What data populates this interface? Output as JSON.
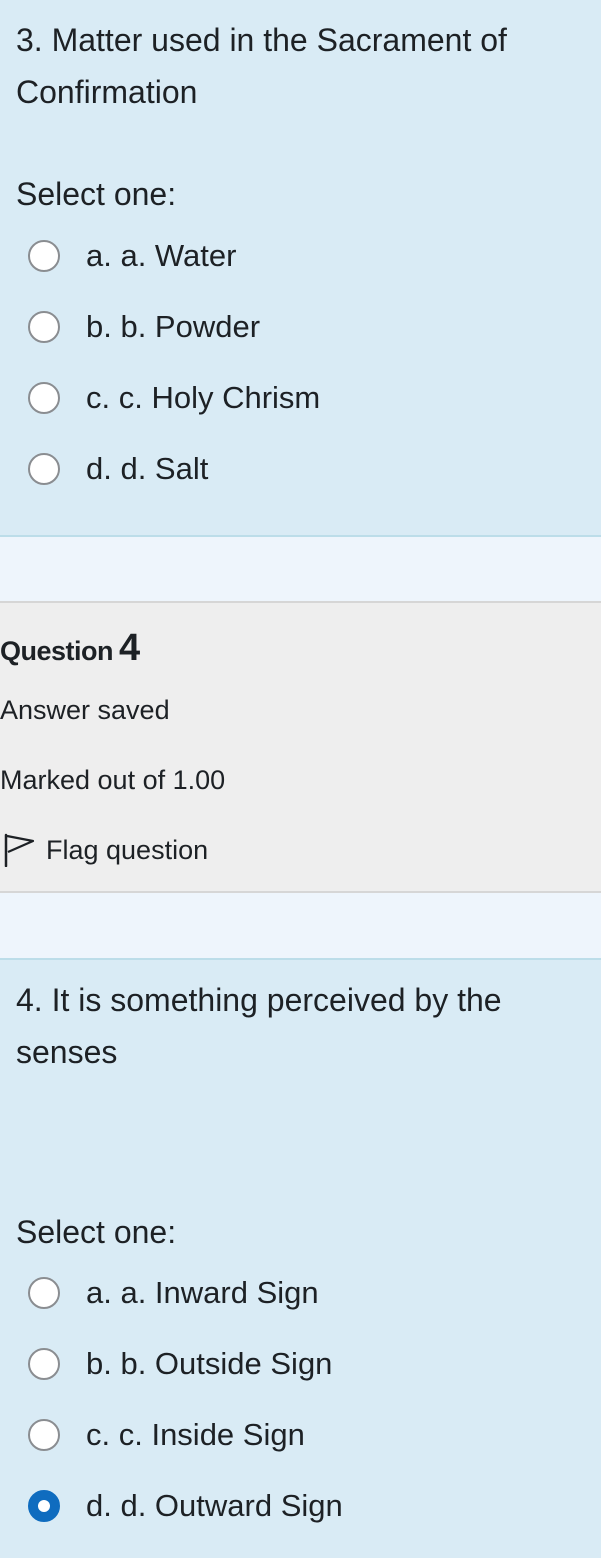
{
  "question3": {
    "text": "3. Matter used in the Sacrament of Confirmation",
    "prompt": "Select one:",
    "options": [
      {
        "label": "a. a. Water",
        "selected": false
      },
      {
        "label": "b. b. Powder",
        "selected": false
      },
      {
        "label": "c. c. Holy Chrism",
        "selected": false
      },
      {
        "label": "d. d. Salt",
        "selected": false
      }
    ]
  },
  "question4": {
    "number_prefix": "Question",
    "number": "4",
    "state": "Answer saved",
    "grade": "Marked out of 1.00",
    "flag_label": "Flag question",
    "text": "4. It is something perceived by the senses",
    "prompt": "Select one:",
    "options": [
      {
        "label": "a. a. Inward Sign",
        "selected": false
      },
      {
        "label": "b. b. Outside Sign",
        "selected": false
      },
      {
        "label": "c. c. Inside Sign",
        "selected": false
      },
      {
        "label": "d. d. Outward Sign",
        "selected": true
      }
    ]
  },
  "icons": {
    "flag": "flag-outline-icon",
    "radio_unchecked": "radio-unchecked-icon",
    "radio_checked": "radio-checked-icon"
  },
  "colors": {
    "question_bg": "#d9ebf5",
    "info_bg": "#eeeeee",
    "accent": "#0f6cbf",
    "text": "#1d2125"
  }
}
